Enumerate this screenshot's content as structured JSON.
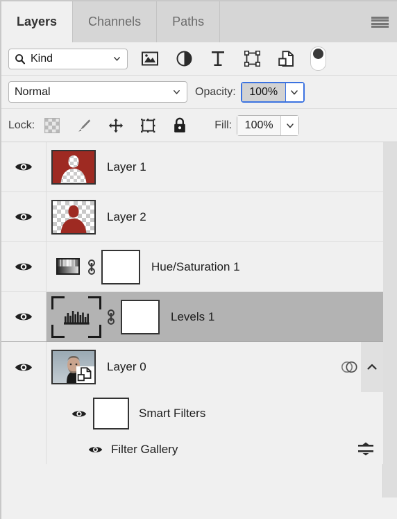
{
  "tabs": [
    {
      "label": "Layers",
      "active": true
    },
    {
      "label": "Channels",
      "active": false
    },
    {
      "label": "Paths",
      "active": false
    }
  ],
  "panel_menu": {
    "name": "panel-menu-icon"
  },
  "filter_bar": {
    "kind_label": "Kind",
    "search_icon": "search-icon",
    "chevron_icon": "chevron-down-icon",
    "filter_icons": [
      "pixel-layer-filter-icon",
      "adjustment-layer-filter-icon",
      "type-layer-filter-icon",
      "shape-layer-filter-icon",
      "smart-object-filter-icon"
    ],
    "toggle_name": "filter-enable-toggle"
  },
  "blend_bar": {
    "blend_mode": "Normal",
    "opacity_label": "Opacity:",
    "opacity_value": "100%"
  },
  "lock_bar": {
    "lock_label": "Lock:",
    "lock_icons": [
      "lock-transparent-pixels-icon",
      "lock-image-pixels-icon",
      "lock-position-icon",
      "lock-artboard-nesting-icon",
      "lock-all-icon"
    ],
    "fill_label": "Fill:",
    "fill_value": "100%"
  },
  "layers": [
    {
      "name": "Layer 1",
      "kind": "pixel",
      "visible": true,
      "selected": false,
      "thumb_style": "red-bg-transparent-silhouette",
      "thumb_bg": "#9e2a22"
    },
    {
      "name": "Layer 2",
      "kind": "pixel",
      "visible": true,
      "selected": false,
      "thumb_style": "transparent-bg-red-silhouette",
      "thumb_fg": "#9e2a22"
    },
    {
      "name": "Hue/Saturation 1",
      "kind": "adjustment",
      "adjustment_icon": "hue-saturation-icon",
      "visible": true,
      "selected": false,
      "linked": true,
      "has_mask": true
    },
    {
      "name": "Levels 1",
      "kind": "adjustment",
      "adjustment_icon": "levels-icon",
      "visible": true,
      "selected": true,
      "linked": true,
      "has_mask": true
    },
    {
      "name": "Layer 0",
      "kind": "smart-object",
      "visible": true,
      "selected": false,
      "smart_filter_indicator": "smart-filters-icon",
      "collapse_icon": "chevron-up-icon"
    }
  ],
  "smart_filters": {
    "group_label": "Smart Filters",
    "group_visible": true,
    "items": [
      {
        "label": "Filter Gallery",
        "visible": true,
        "blending_icon": "filter-blending-options-icon"
      }
    ]
  },
  "colors": {
    "panel_bg": "#f0f0f0",
    "tab_inactive_bg": "#d6d6d6",
    "selected_row": "#b3b3b3",
    "focus_border": "#3b72e0",
    "silhouette_red": "#9e2a22"
  }
}
